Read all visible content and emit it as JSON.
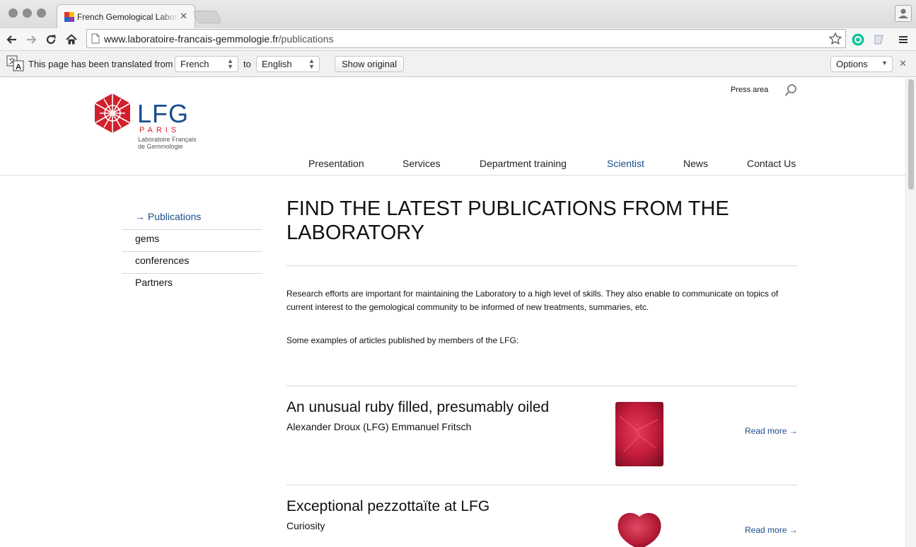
{
  "browser": {
    "tab_title": "French Gemological Laboratoire",
    "url_domain": "www.laboratoire-francais-gemmologie.fr",
    "url_path": "/publications"
  },
  "translate_bar": {
    "message": "This page has been translated from",
    "from_lang": "French",
    "to_word": "to",
    "to_lang": "English",
    "show_original": "Show original",
    "options": "Options"
  },
  "site": {
    "logo": {
      "name": "LFG",
      "city": "PARIS",
      "subtitle_line1": "Laboratoire Français",
      "subtitle_line2": "de Gemmologie"
    },
    "press_area": "Press area",
    "nav": [
      "Presentation",
      "Services",
      "Department training",
      "Scientist",
      "News",
      "Contact Us"
    ],
    "nav_active": "Scientist"
  },
  "sidebar": {
    "items": [
      "→ Publications",
      "gems",
      "conferences",
      "Partners"
    ],
    "active": "→ Publications"
  },
  "main": {
    "heading": "FIND THE LATEST PUBLICATIONS FROM THE LABORATORY",
    "intro": "Research efforts are important for maintaining the Laboratory to a high level of skills. They also enable to communicate on topics of current interest to the gemological community to be informed of new treatments, summaries, etc.",
    "examples": "Some examples of articles published by members of the LFG:",
    "articles": [
      {
        "title": "An unusual ruby filled, presumably oiled",
        "author": "Alexander Droux (LFG) Emmanuel Fritsch",
        "read_more": "Read more →"
      },
      {
        "title": "Exceptional pezzottaïte at LFG",
        "author": "Curiosity",
        "read_more": "Read more →"
      }
    ]
  },
  "colors": {
    "brand_blue": "#1a4d8c",
    "brand_red": "#d21f2c",
    "ruby": "#c41c3c"
  }
}
